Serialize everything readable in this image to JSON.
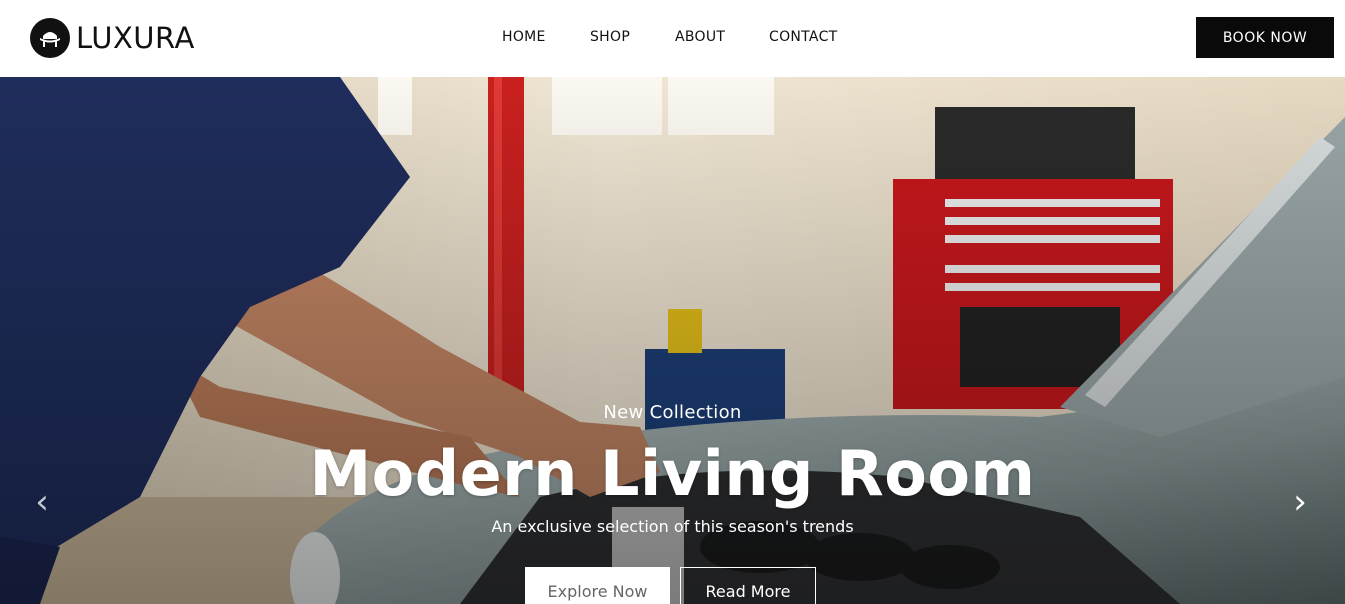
{
  "brand": {
    "name": "LUXURA",
    "logo_icon": "chair-icon"
  },
  "nav": {
    "items": [
      {
        "label": "HOME"
      },
      {
        "label": "SHOP"
      },
      {
        "label": "ABOUT"
      },
      {
        "label": "CONTACT"
      }
    ],
    "cta_label": "BOOK NOW"
  },
  "hero": {
    "kicker": "New Collection",
    "title": "Modern Living Room",
    "subtitle": "An exclusive selection of this season's trends",
    "primary_button": "Explore Now",
    "secondary_button": "Read More",
    "prev_arrow": "‹",
    "next_arrow": "›",
    "image": "mechanic working on classic car engine in garage"
  },
  "colors": {
    "header_bg": "#ffffff",
    "cta_bg": "#0a0a0a",
    "text_dark": "#111111",
    "hero_text": "#ffffff"
  }
}
